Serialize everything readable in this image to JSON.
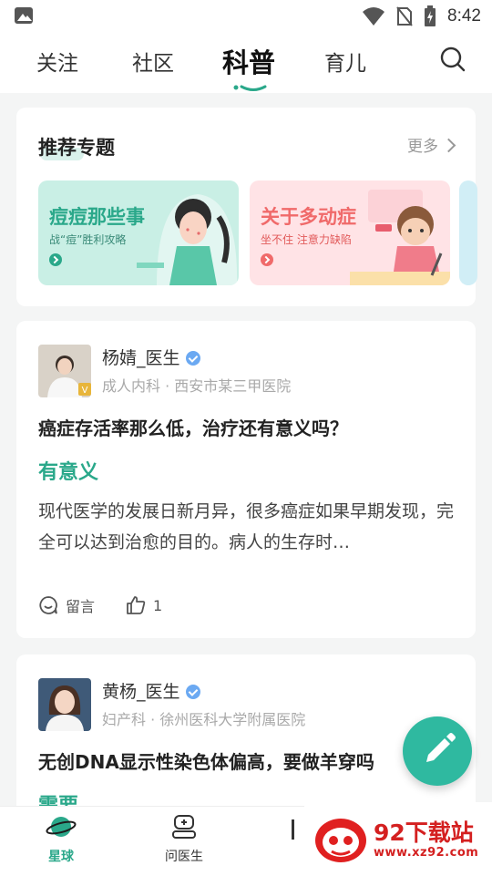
{
  "status_bar": {
    "time": "8:42"
  },
  "top_tabs": [
    {
      "label": "关注",
      "active": false
    },
    {
      "label": "社区",
      "active": false
    },
    {
      "label": "科普",
      "active": true
    },
    {
      "label": "育儿",
      "active": false
    }
  ],
  "recommend": {
    "title": "推荐专题",
    "more_label": "更多",
    "topics": [
      {
        "title": "痘痘那些事",
        "subtitle": "战“痘”胜利攻略"
      },
      {
        "title": "关于多动症",
        "subtitle": "坐不住 注意力缺陷"
      }
    ]
  },
  "posts": [
    {
      "author": "杨婧_医生",
      "dept": "成人内科 · 西安市某三甲医院",
      "title": "癌症存活率那么低，治疗还有意义吗？",
      "answer": "有意义",
      "excerpt": "现代医学的发展日新月异，很多癌症如果早期发现，完全可以达到治愈的目的。病人的生存时…",
      "comment_label": "留言",
      "like_count": "1"
    },
    {
      "author": "黄杨_医生",
      "dept": "妇产科 · 徐州医科大学附属医院",
      "title": "无创DNA显示性染色体偏高，要做羊穿吗",
      "answer": "需要"
    }
  ],
  "bottom_nav": [
    {
      "label": "星球",
      "active": true
    },
    {
      "label": "问医生",
      "active": false
    }
  ],
  "watermark": {
    "name": "92下载站",
    "url": "www.xz92.com"
  },
  "colors": {
    "accent": "#2aa88a",
    "fab": "#2fb9a0",
    "pink": "#f06a6a"
  }
}
